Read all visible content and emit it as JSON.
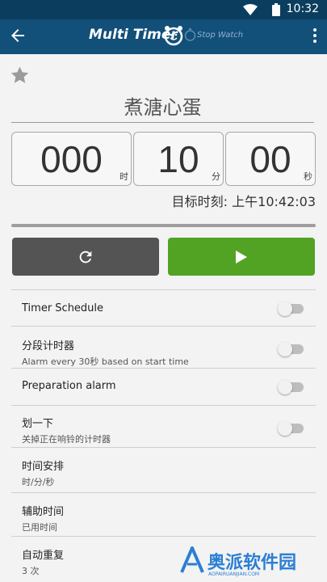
{
  "status_bar": {
    "time": "10:32"
  },
  "app_bar": {
    "title": "Multi Timer",
    "secondary_label": "Stop Watch"
  },
  "timer": {
    "name": "煮溏心蛋",
    "hours": "000",
    "hours_unit": "时",
    "minutes": "10",
    "minutes_unit": "分",
    "seconds": "00",
    "seconds_unit": "秒",
    "target_time": "目标时刻: 上午10:42:03"
  },
  "settings": [
    {
      "label": "Timer Schedule",
      "sub": "",
      "toggle": false
    },
    {
      "label": "分段计时器",
      "sub": "Alarm every 30秒 based on start time",
      "toggle": false
    },
    {
      "label": "Preparation alarm",
      "sub": "",
      "toggle": false
    },
    {
      "label": "划一下",
      "sub": "关掉正在响铃的计时器",
      "toggle": false
    },
    {
      "label": "时间安排",
      "sub": "时/分/秒"
    },
    {
      "label": "辅助时间",
      "sub": "已用时间"
    },
    {
      "label": "自动重复",
      "sub": "3 次"
    }
  ],
  "watermark": {
    "text": "奥派软件园",
    "sub": "AOPAIRUANJIAN.COM"
  },
  "colors": {
    "app_bar": "#124f79",
    "status_bar": "#0b3e5e",
    "start_button": "#52a324",
    "reset_button": "#545454"
  }
}
